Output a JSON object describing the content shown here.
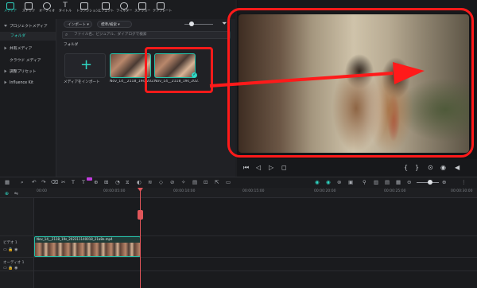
{
  "toolbar": {
    "items": [
      {
        "label": "メディア",
        "icon": "media-icon",
        "active": true
      },
      {
        "label": "ストック",
        "icon": "stock-icon"
      },
      {
        "label": "オーディオ",
        "icon": "audio-icon"
      },
      {
        "label": "タイトル",
        "icon": "title-icon"
      },
      {
        "label": "トランジション",
        "icon": "transition-icon"
      },
      {
        "label": "エフェクト",
        "icon": "effect-icon"
      },
      {
        "label": "フィルター",
        "icon": "filter-icon"
      },
      {
        "label": "ステッカー",
        "icon": "sticker-icon"
      },
      {
        "label": "テンプレート",
        "icon": "template-icon"
      }
    ]
  },
  "sidebar": {
    "items": [
      {
        "label": "プロジェクトメディア"
      },
      {
        "label": "フォルダ"
      },
      {
        "label": "共有メディア"
      },
      {
        "label": "クラウド メディア"
      },
      {
        "label": "調整プリセット"
      },
      {
        "label": "Influence Kit"
      }
    ]
  },
  "media": {
    "import_label": "インポート",
    "sort_label": "標準/検索",
    "search_placeholder": "ファイル名、ビジュアル、ダイアログで検索",
    "folder_label": "フォルダ",
    "import_card_label": "メディアをインポート",
    "clips": [
      {
        "label": "Nov_14__2118_19s_202..."
      },
      {
        "label": "Nov_14__2118_19s_202..."
      }
    ]
  },
  "timeline": {
    "ruler": [
      "00:00",
      "00:00:05:00",
      "00:00:10:00",
      "00:00:15:00",
      "00:00:20:00",
      "00:00:25:00",
      "00:00:30:00",
      "00:00:35:00"
    ],
    "playhead_label": "",
    "tracks": [
      {
        "label": "ビデオ 1"
      },
      {
        "label": "オーディオ 1"
      }
    ],
    "clip_name": "Nov_14__2118_19s_202311140018_21a8e.mp4"
  },
  "annotation": {
    "color": "#ff1a1a"
  }
}
